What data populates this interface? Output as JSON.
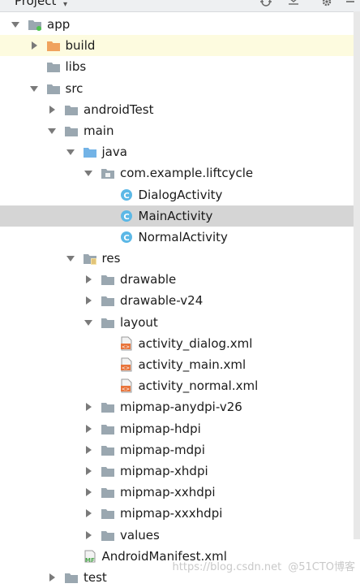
{
  "toolbar": {
    "title": "Project"
  },
  "tree": [
    {
      "label": "app",
      "depth": 0,
      "arrow": "down",
      "icon": "module-folder-icon"
    },
    {
      "label": "build",
      "depth": 1,
      "arrow": "right",
      "icon": "build-folder-icon",
      "highlight": true
    },
    {
      "label": "libs",
      "depth": 1,
      "arrow": "none",
      "icon": "folder-icon"
    },
    {
      "label": "src",
      "depth": 1,
      "arrow": "down",
      "icon": "folder-icon"
    },
    {
      "label": "androidTest",
      "depth": 2,
      "arrow": "right",
      "icon": "folder-icon"
    },
    {
      "label": "main",
      "depth": 2,
      "arrow": "down",
      "icon": "folder-icon"
    },
    {
      "label": "java",
      "depth": 3,
      "arrow": "down",
      "icon": "source-folder-icon"
    },
    {
      "label": "com.example.liftcycle",
      "depth": 4,
      "arrow": "down",
      "icon": "package-icon"
    },
    {
      "label": "DialogActivity",
      "depth": 5,
      "arrow": "none",
      "icon": "class-icon"
    },
    {
      "label": "MainActivity",
      "depth": 5,
      "arrow": "none",
      "icon": "class-icon",
      "selected": true
    },
    {
      "label": "NormalActivity",
      "depth": 5,
      "arrow": "none",
      "icon": "class-icon"
    },
    {
      "label": "res",
      "depth": 3,
      "arrow": "down",
      "icon": "resource-folder-icon"
    },
    {
      "label": "drawable",
      "depth": 4,
      "arrow": "right",
      "icon": "folder-icon"
    },
    {
      "label": "drawable-v24",
      "depth": 4,
      "arrow": "right",
      "icon": "folder-icon"
    },
    {
      "label": "layout",
      "depth": 4,
      "arrow": "down",
      "icon": "folder-icon"
    },
    {
      "label": "activity_dialog.xml",
      "depth": 5,
      "arrow": "none",
      "icon": "layout-xml-icon"
    },
    {
      "label": "activity_main.xml",
      "depth": 5,
      "arrow": "none",
      "icon": "layout-xml-icon"
    },
    {
      "label": "activity_normal.xml",
      "depth": 5,
      "arrow": "none",
      "icon": "layout-xml-icon"
    },
    {
      "label": "mipmap-anydpi-v26",
      "depth": 4,
      "arrow": "right",
      "icon": "folder-icon"
    },
    {
      "label": "mipmap-hdpi",
      "depth": 4,
      "arrow": "right",
      "icon": "folder-icon"
    },
    {
      "label": "mipmap-mdpi",
      "depth": 4,
      "arrow": "right",
      "icon": "folder-icon"
    },
    {
      "label": "mipmap-xhdpi",
      "depth": 4,
      "arrow": "right",
      "icon": "folder-icon"
    },
    {
      "label": "mipmap-xxhdpi",
      "depth": 4,
      "arrow": "right",
      "icon": "folder-icon"
    },
    {
      "label": "mipmap-xxxhdpi",
      "depth": 4,
      "arrow": "right",
      "icon": "folder-icon"
    },
    {
      "label": "values",
      "depth": 4,
      "arrow": "right",
      "icon": "folder-icon"
    },
    {
      "label": "AndroidManifest.xml",
      "depth": 3,
      "arrow": "none",
      "icon": "manifest-icon"
    },
    {
      "label": "test",
      "depth": 2,
      "arrow": "right",
      "icon": "folder-icon"
    }
  ],
  "watermark": {
    "text": "https://blog.csdn.net",
    "brand": "@51CTO博客"
  },
  "colors": {
    "folder": "#9aa7b0",
    "build_folder": "#f0a35e",
    "source_folder": "#73b3e6",
    "class_circle": "#5cb8e6",
    "highlight_row": "#fdfbdf",
    "selected_row": "#d5d5d5",
    "module_dot": "#4ec34e"
  }
}
